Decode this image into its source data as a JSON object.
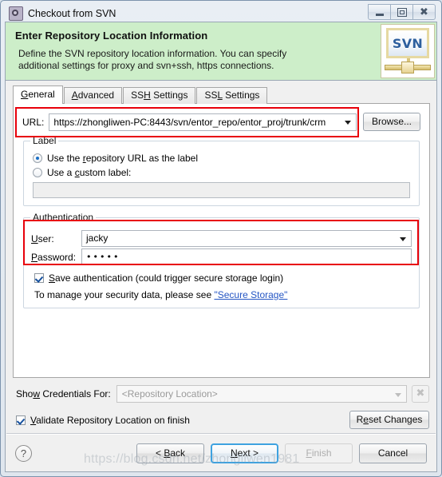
{
  "window": {
    "title": "Checkout from SVN",
    "icon": "svn-gear-icon",
    "controls": {
      "minimize": "Minimize",
      "maximize": "Maximize",
      "close": "Close"
    }
  },
  "banner": {
    "heading": "Enter Repository Location Information",
    "description_line1": "Define the SVN repository location information. You can specify",
    "description_line2": "additional settings for proxy and svn+ssh, https connections.",
    "logo_text": "SVN",
    "background_color": "#cdeec9"
  },
  "tabs": [
    {
      "label": "General",
      "active": true
    },
    {
      "label": "Advanced",
      "active": false
    },
    {
      "label": "SSH Settings",
      "active": false
    },
    {
      "label": "SSL Settings",
      "active": false
    }
  ],
  "url_row": {
    "label": "URL:",
    "value": "https://zhongliwen-PC:8443/svn/entor_repo/entor_proj/trunk/crm",
    "browse_label": "Browse..."
  },
  "label_group": {
    "title": "Label",
    "option_repository_url": "Use the repository URL as the label",
    "option_custom_label": "Use a custom label:",
    "selected": "repository_url",
    "custom_label_value": "",
    "custom_label_enabled": false
  },
  "authentication": {
    "title": "Authentication",
    "user_label": "User:",
    "user_value": "jacky",
    "password_label": "Password:",
    "password_value": "•••••",
    "save_auth_label": "Save authentication (could trigger secure storage login)",
    "save_auth_checked": true,
    "secure_storage_hint": "To manage your security data, please see",
    "secure_storage_link": "\"Secure Storage\""
  },
  "credentials": {
    "label": "Show Credentials For:",
    "value": "<Repository Location>",
    "clear_icon": "✖",
    "enabled": false
  },
  "validate": {
    "label": "Validate Repository Location on finish",
    "checked": true,
    "reset_label": "Reset Changes"
  },
  "buttonbar": {
    "help_icon": "?",
    "back": "< Back",
    "next": "Next >",
    "finish": "Finish",
    "cancel": "Cancel",
    "default_button": "Next >",
    "disabled_button": "Finish"
  },
  "highlight_color": "#e8000a",
  "watermark": "https://blog.csdn.net/zhongliwen1981"
}
